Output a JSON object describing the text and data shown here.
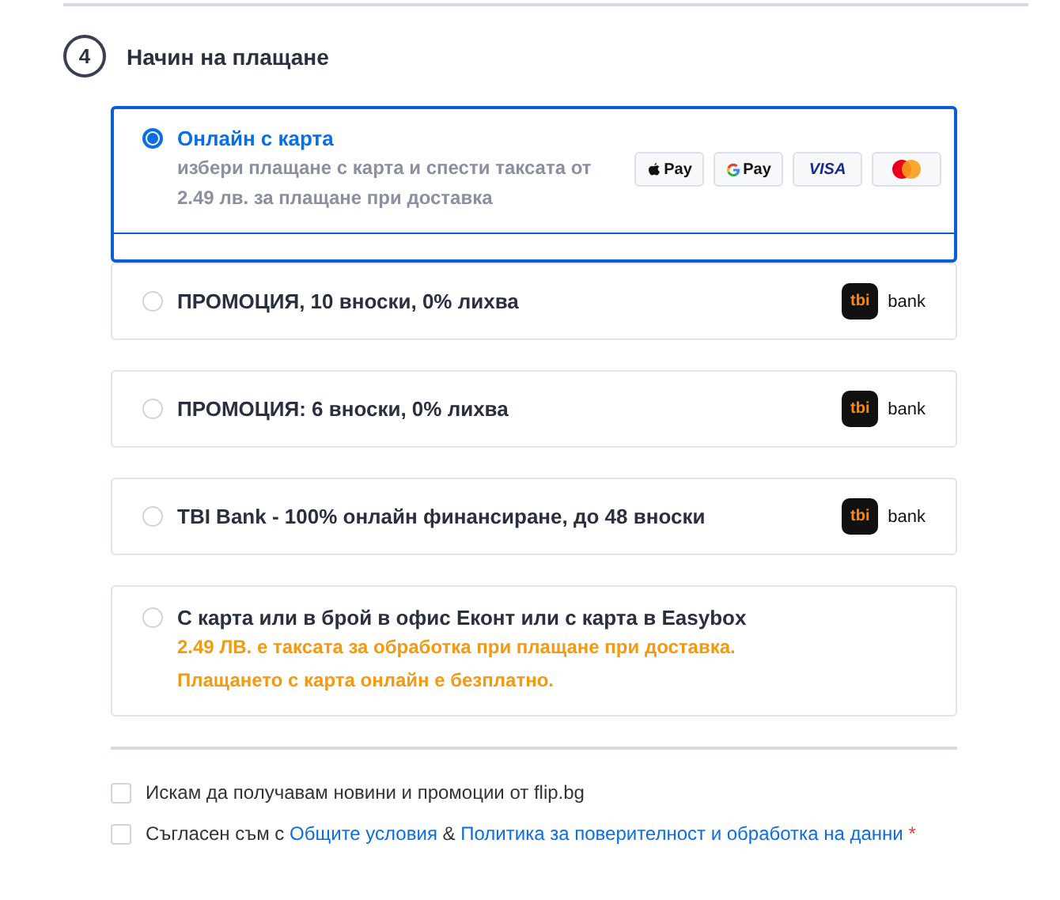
{
  "section": {
    "number": "4",
    "title": "Начин на плащане"
  },
  "payment_options": [
    {
      "kind": "card",
      "label": "Онлайн с карта",
      "selected": true,
      "description": "избери плащане с карта и спести таксата от 2.49 лв. за плащане при доставка",
      "badges": [
        {
          "kind": "apple",
          "label": "Pay"
        },
        {
          "kind": "google",
          "label": "Pay"
        },
        {
          "kind": "visa",
          "label": "VISA"
        },
        {
          "kind": "mastercard"
        }
      ]
    },
    {
      "kind": "tbi",
      "label": "ПРОМОЦИЯ, 10 вноски, 0% лихва",
      "selected": false,
      "logo": {
        "mark": "tbi",
        "word": "bank"
      }
    },
    {
      "kind": "tbi",
      "label": "ПРОМОЦИЯ: 6 вноски, 0% лихва",
      "selected": false,
      "logo": {
        "mark": "tbi",
        "word": "bank"
      }
    },
    {
      "kind": "tbi",
      "label": "TBI Bank - 100% онлайн финансиране, до 48 вноски",
      "selected": false,
      "logo": {
        "mark": "tbi",
        "word": "bank"
      }
    },
    {
      "kind": "cod",
      "label": "С карта или в брой в офис Еконт или с карта в Easybox",
      "selected": false,
      "notes": [
        "2.49 ЛВ. е таксата за обработка при плащане при доставка.",
        "Плащането с карта онлайн е безплатно."
      ]
    }
  ],
  "newsletter": {
    "label": "Искам да получавам новини и промоции от flip.bg",
    "checked": false
  },
  "consent": {
    "checked": false,
    "text": "Съгласен съм с",
    "links": [
      "Общите условия",
      "Политика за поверителност и обработка на данни"
    ],
    "separator": "&",
    "required_mark": "*"
  }
}
